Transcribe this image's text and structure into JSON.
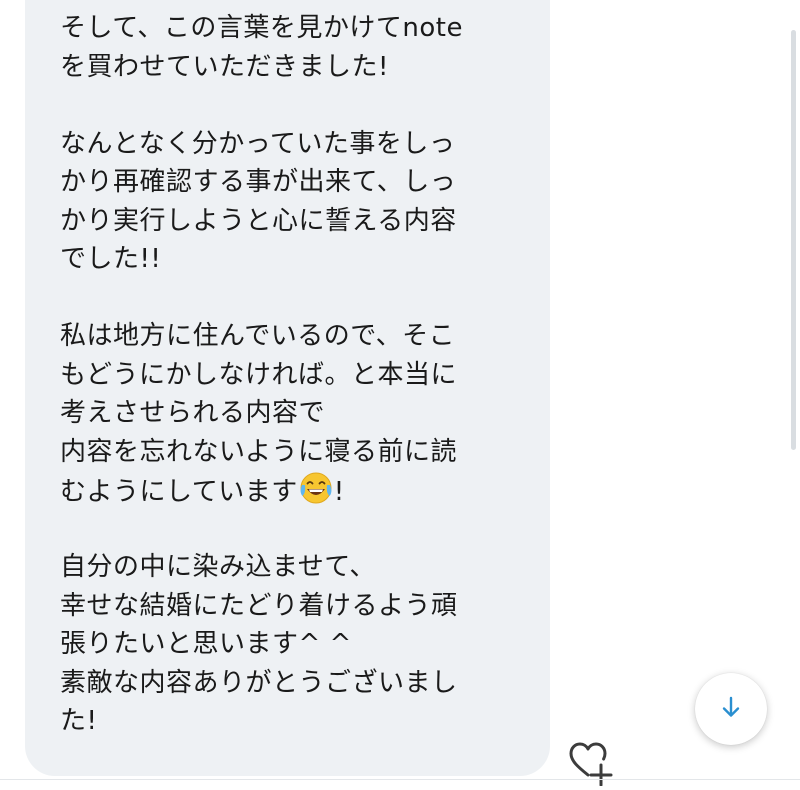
{
  "message": {
    "lines": [
      "そして、この言葉を見かけてnote",
      "を買わせていただきました!",
      "",
      "なんとなく分かっていた事をしっ",
      "かり再確認する事が出来て、しっ",
      "かり実行しようと心に誓える内容",
      "でした!!",
      "",
      "私は地方に住んでいるので、そこ",
      "もどうにかしなければ。と本当に",
      "考えさせられる内容で",
      "内容を忘れないように寝る前に読",
      "",
      "",
      "自分の中に染み込ませて、",
      "幸せな結婚にたどり着けるよう頑",
      "張りたいと思います^ ^",
      "素敵な内容ありがとうございまし",
      "た!"
    ],
    "emoji_line": {
      "before": "むようにしています",
      "emoji_icon": "face-with-tears-of-joy-emoji",
      "after": "!"
    }
  },
  "controls": {
    "scroll_down_icon": "arrow-down-icon",
    "like_icon": "heart-plus-icon"
  },
  "colors": {
    "bubble_background": "#eef1f4",
    "text": "#1a1a1a",
    "accent": "#2a8fd0",
    "icon_gray": "#3c3c3c"
  }
}
